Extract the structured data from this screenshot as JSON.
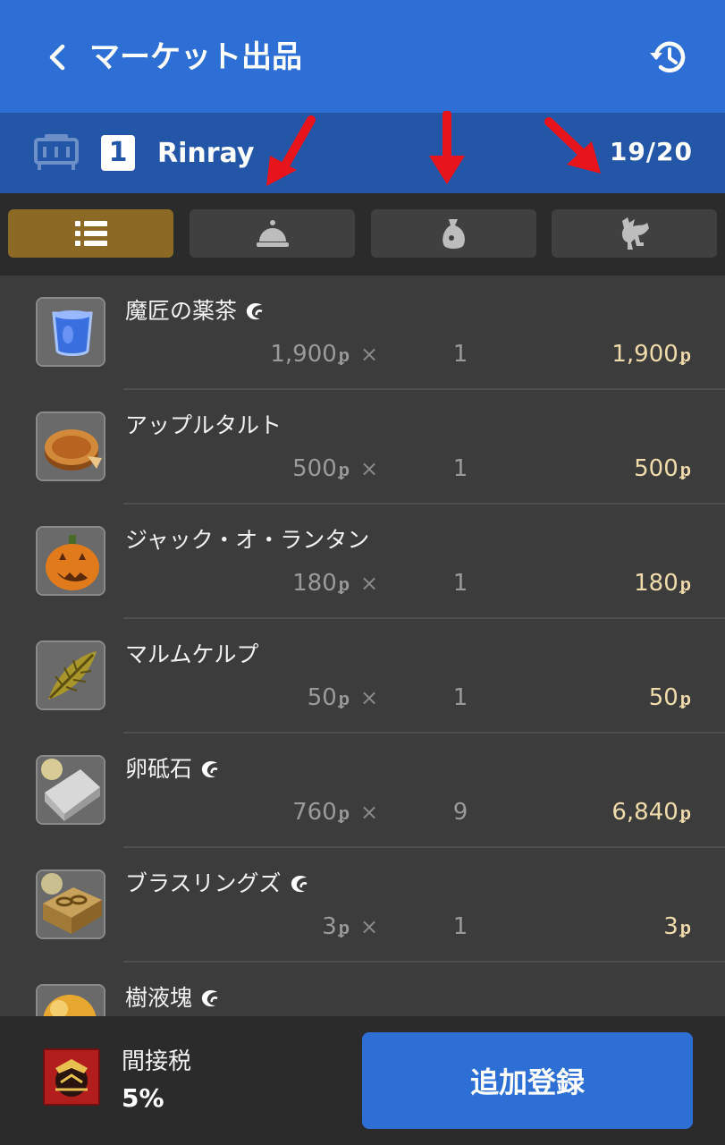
{
  "header": {
    "title": "マーケット出品",
    "back_icon": "chevron-left-icon",
    "history_icon": "history-icon"
  },
  "retainer": {
    "number": "1",
    "name": "Rinray",
    "slots": "19/20"
  },
  "tabs": [
    {
      "icon": "list-icon",
      "active": true
    },
    {
      "icon": "bell-icon",
      "active": false
    },
    {
      "icon": "bag-icon",
      "active": false
    },
    {
      "icon": "chocobo-icon",
      "active": false
    }
  ],
  "items": [
    {
      "name": "魔匠の薬茶",
      "hq": true,
      "unit_price": "1,900",
      "qty": "1",
      "total": "1,900",
      "icon": "blue-tea-icon"
    },
    {
      "name": "アップルタルト",
      "hq": false,
      "unit_price": "500",
      "qty": "1",
      "total": "500",
      "icon": "apple-tart-icon"
    },
    {
      "name": "ジャック・オ・ランタン",
      "hq": false,
      "unit_price": "180",
      "qty": "1",
      "total": "180",
      "icon": "pumpkin-icon"
    },
    {
      "name": "マルムケルプ",
      "hq": false,
      "unit_price": "50",
      "qty": "1",
      "total": "50",
      "icon": "kelp-icon"
    },
    {
      "name": "卵砥石",
      "hq": true,
      "unit_price": "760",
      "qty": "9",
      "total": "6,840",
      "icon": "whetstone-icon"
    },
    {
      "name": "ブラスリングズ",
      "hq": true,
      "unit_price": "3",
      "qty": "1",
      "total": "3",
      "icon": "brass-rings-icon"
    },
    {
      "name": "樹液塊",
      "hq": true,
      "unit_price": "",
      "qty": "",
      "total": "",
      "icon": "sap-icon"
    }
  ],
  "common": {
    "times": "×",
    "gil_symbol": "ᵱ"
  },
  "footer": {
    "tax_label": "間接税",
    "tax_value": "5%",
    "add_button": "追加登録"
  },
  "colors": {
    "header_blue": "#2d6fd4",
    "bar_blue": "#2456a8",
    "active_tab": "#8c6a26",
    "total_text": "#f0dcaa",
    "annotation_arrow": "#e8141b"
  }
}
